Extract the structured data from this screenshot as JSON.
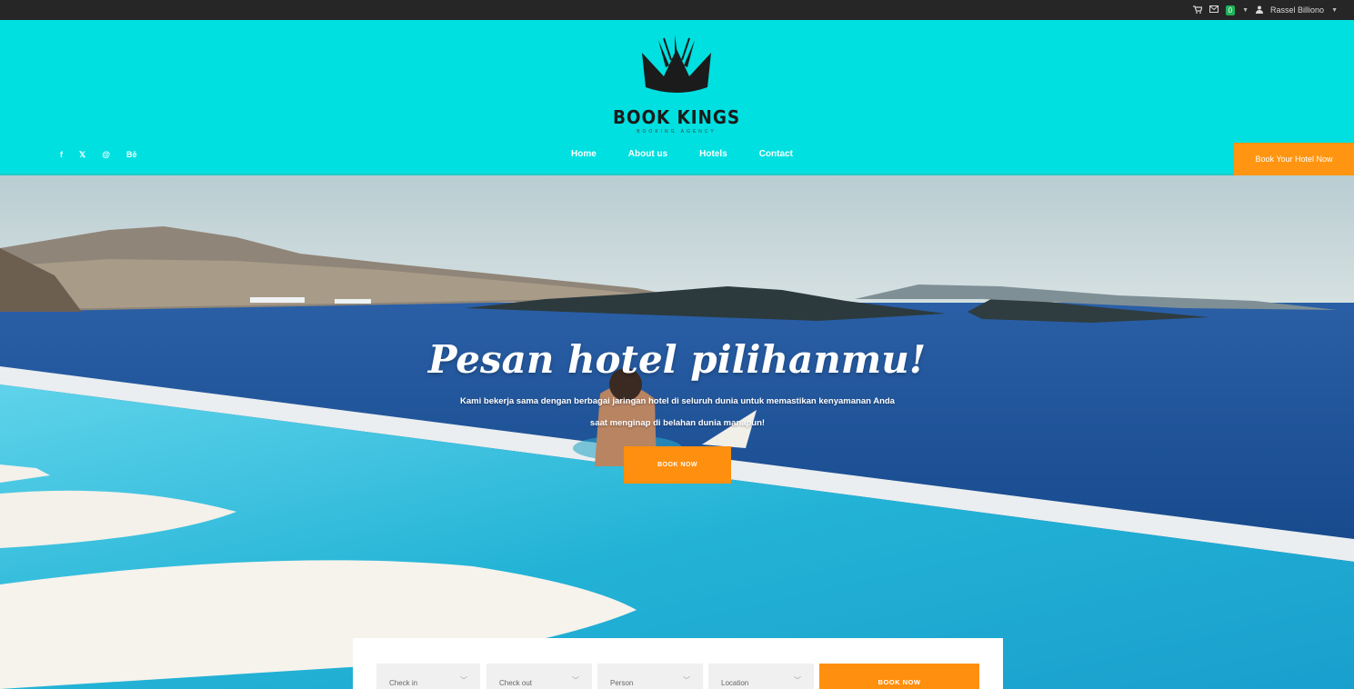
{
  "topbar": {
    "badge_count": "0",
    "user_name": "Rassel Billiono"
  },
  "header": {
    "logo_name": "BOOK KINGS",
    "logo_subtitle": "BOOKING AGENCY",
    "social": [
      "f",
      "𝕏",
      "@",
      "Bē"
    ],
    "nav": [
      "Home",
      "About us",
      "Hotels",
      "Contact"
    ],
    "cta": "Book Your Hotel Now"
  },
  "hero": {
    "title": "Pesan hotel pilihanmu!",
    "description": "Kami bekerja sama dengan berbagai jaringan hotel di seluruh dunia untuk memastikan kenyamanan Anda saat menginap di belahan dunia manapun!",
    "button": "BOOK NOW"
  },
  "search": {
    "checkin": "Check in",
    "checkout": "Check out",
    "person": "Person",
    "location": "Location",
    "button": "BOOK NOW"
  },
  "colors": {
    "header_bg": "#00e0e0",
    "accent": "#ff8f0e",
    "topbar_bg": "#262626"
  }
}
